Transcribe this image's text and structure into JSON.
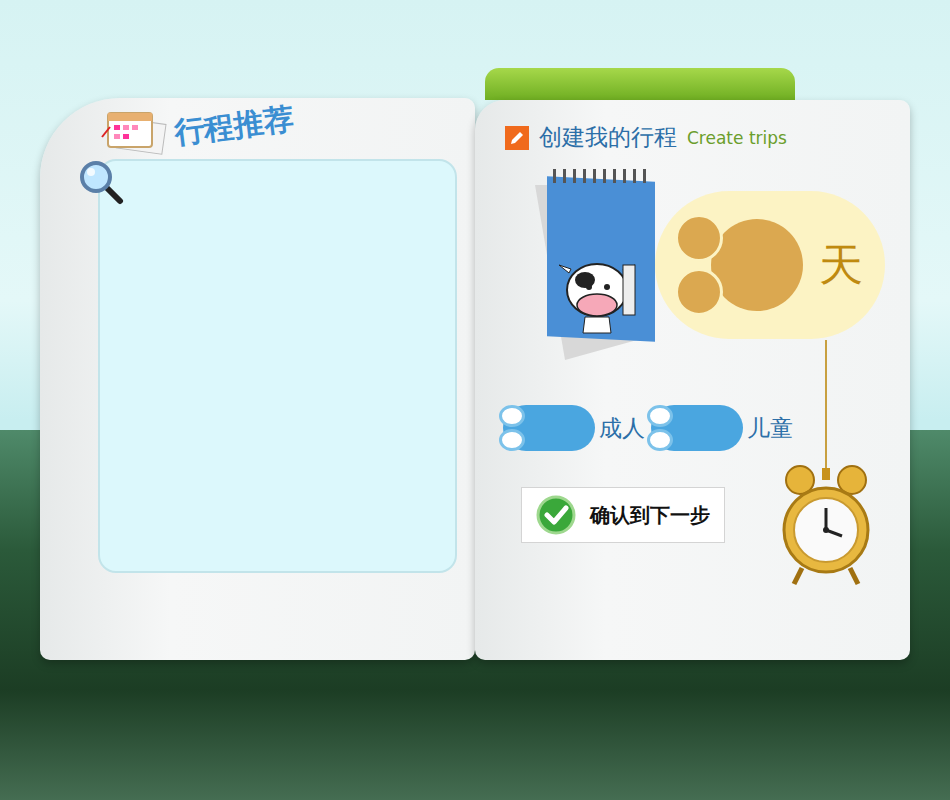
{
  "recommend": {
    "title": "行程推荐"
  },
  "create": {
    "title": "创建我的行程",
    "subtitle": "Create trips",
    "days_unit": "天",
    "travellers": [
      {
        "label": "成人"
      },
      {
        "label": "儿童"
      }
    ],
    "confirm_button": "确认到下一步"
  }
}
